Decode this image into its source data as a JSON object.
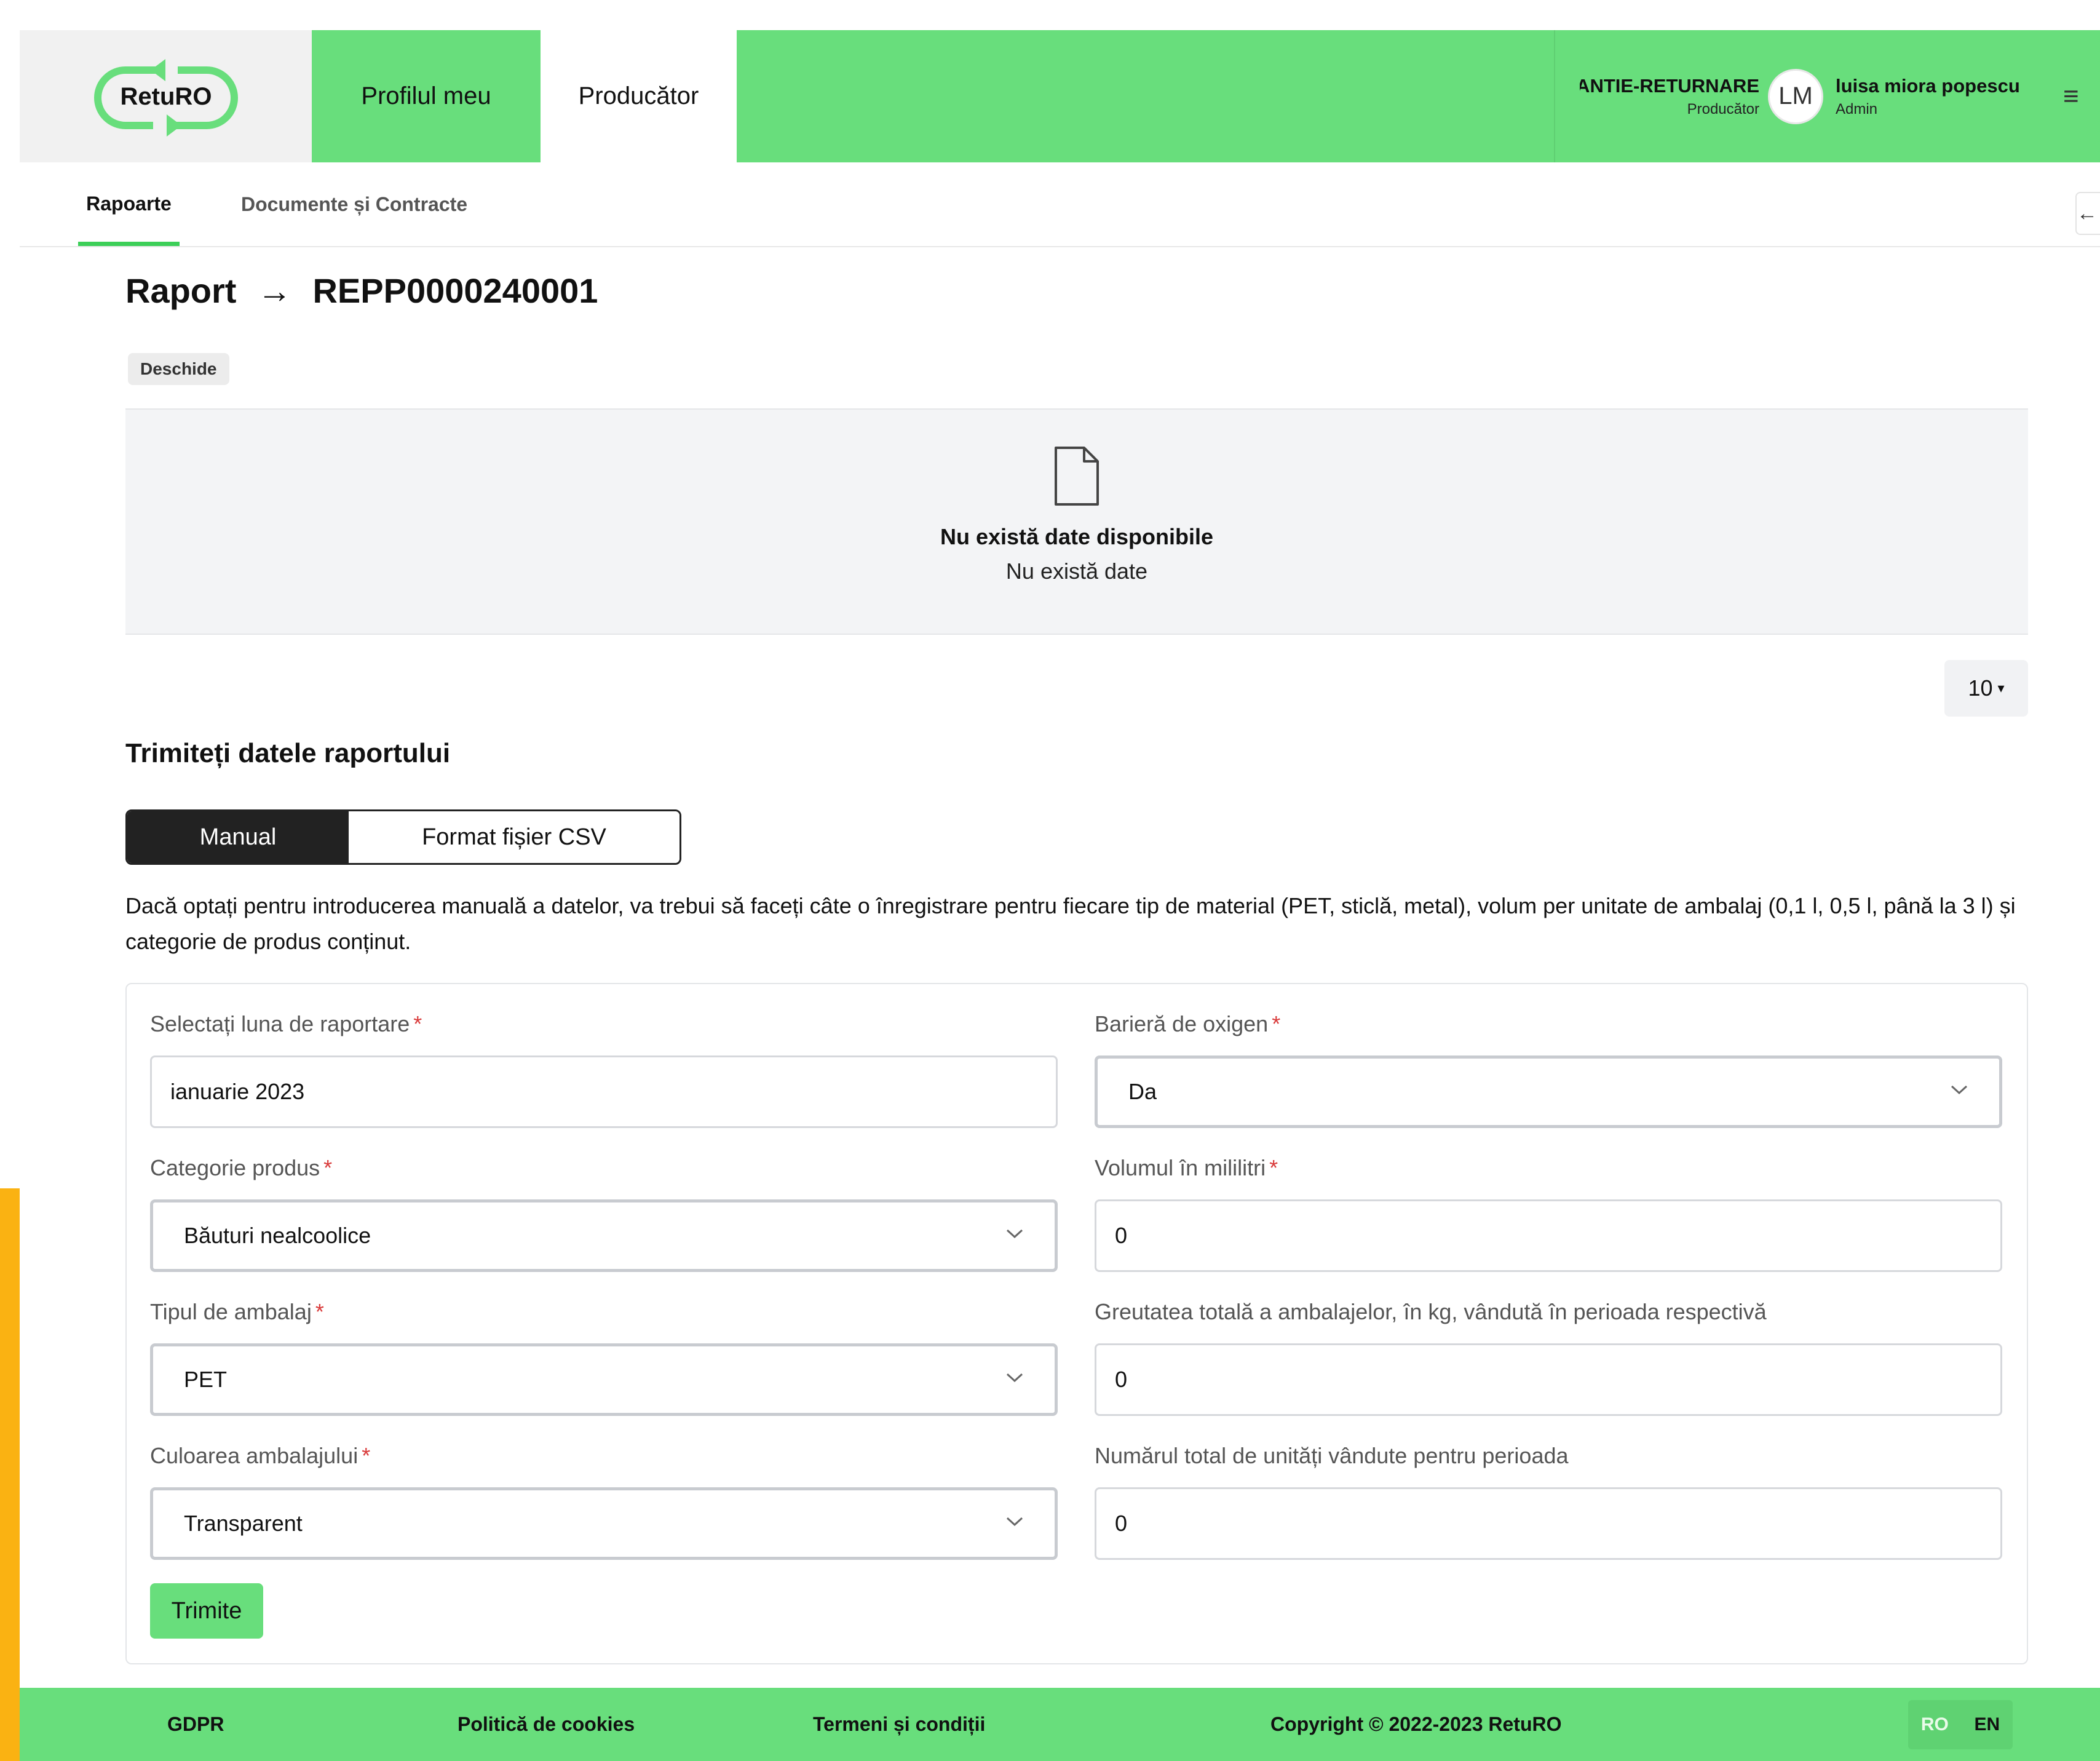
{
  "header": {
    "logo_text": "RetuRO",
    "nav": {
      "profile": "Profilul meu",
      "producator": "Producător"
    },
    "org": {
      "name": "RETURO SISTEM GARANTIE-RETURNARE",
      "role": "Producător"
    },
    "user": {
      "initials": "LM",
      "name": "luisa miora popescu",
      "role": "Admin"
    },
    "menu_icon": "≡"
  },
  "subnav": {
    "tabs": [
      {
        "label": "Rapoarte"
      },
      {
        "label": "Documente și Contracte"
      }
    ],
    "back_icon": "←"
  },
  "page": {
    "title_prefix": "Raport",
    "arrow": "→",
    "report_id": "REPP0000240001",
    "status": "Deschide"
  },
  "empty_state": {
    "title": "Nu există date disponibile",
    "subtitle": "Nu există date"
  },
  "pagination": {
    "page_size": "10",
    "caret": "▾"
  },
  "section": {
    "title": "Trimiteți datele raportului",
    "toggle": {
      "manual": "Manual",
      "csv": "Format fișier CSV"
    },
    "description": "Dacă optați pentru introducerea manuală a datelor, va trebui să faceți câte o înregistrare pentru fiecare tip de material (PET, sticlă, metal), volum per unitate de ambalaj (0,1 l, 0,5 l, până la 3 l) și categorie de produs conținut."
  },
  "form": {
    "required_mark": "*",
    "fields": {
      "luna": {
        "label": "Selectați luna de raportare",
        "value": "ianuarie 2023"
      },
      "categorie": {
        "label": "Categorie produs",
        "value": "Băuturi nealcoolice"
      },
      "tip": {
        "label": "Tipul de ambalaj",
        "value": "PET"
      },
      "culoare": {
        "label": "Culoarea ambalajului",
        "value": "Transparent"
      },
      "bariera": {
        "label": "Barieră de oxigen",
        "value": "Da"
      },
      "volum": {
        "label": "Volumul în mililitri",
        "value": "0"
      },
      "greutate": {
        "label": "Greutatea totală a ambalajelor, în kg, vândută în perioada respectivă",
        "value": "0"
      },
      "unitati": {
        "label": "Numărul total de unități vândute pentru perioada",
        "value": "0"
      }
    },
    "submit_label": "Trimite"
  },
  "footer": {
    "gdpr": "GDPR",
    "cookies": "Politică de cookies",
    "terms": "Termeni și condiții",
    "copyright": "Copyright © 2022-2023 RetuRO",
    "lang": {
      "ro": "RO",
      "en": "EN"
    }
  },
  "colors": {
    "brand_green": "#68de7c",
    "accent_underline": "#3ccf58",
    "dark": "#222222",
    "required": "#d93a3a",
    "side_strip": "#fab212"
  }
}
